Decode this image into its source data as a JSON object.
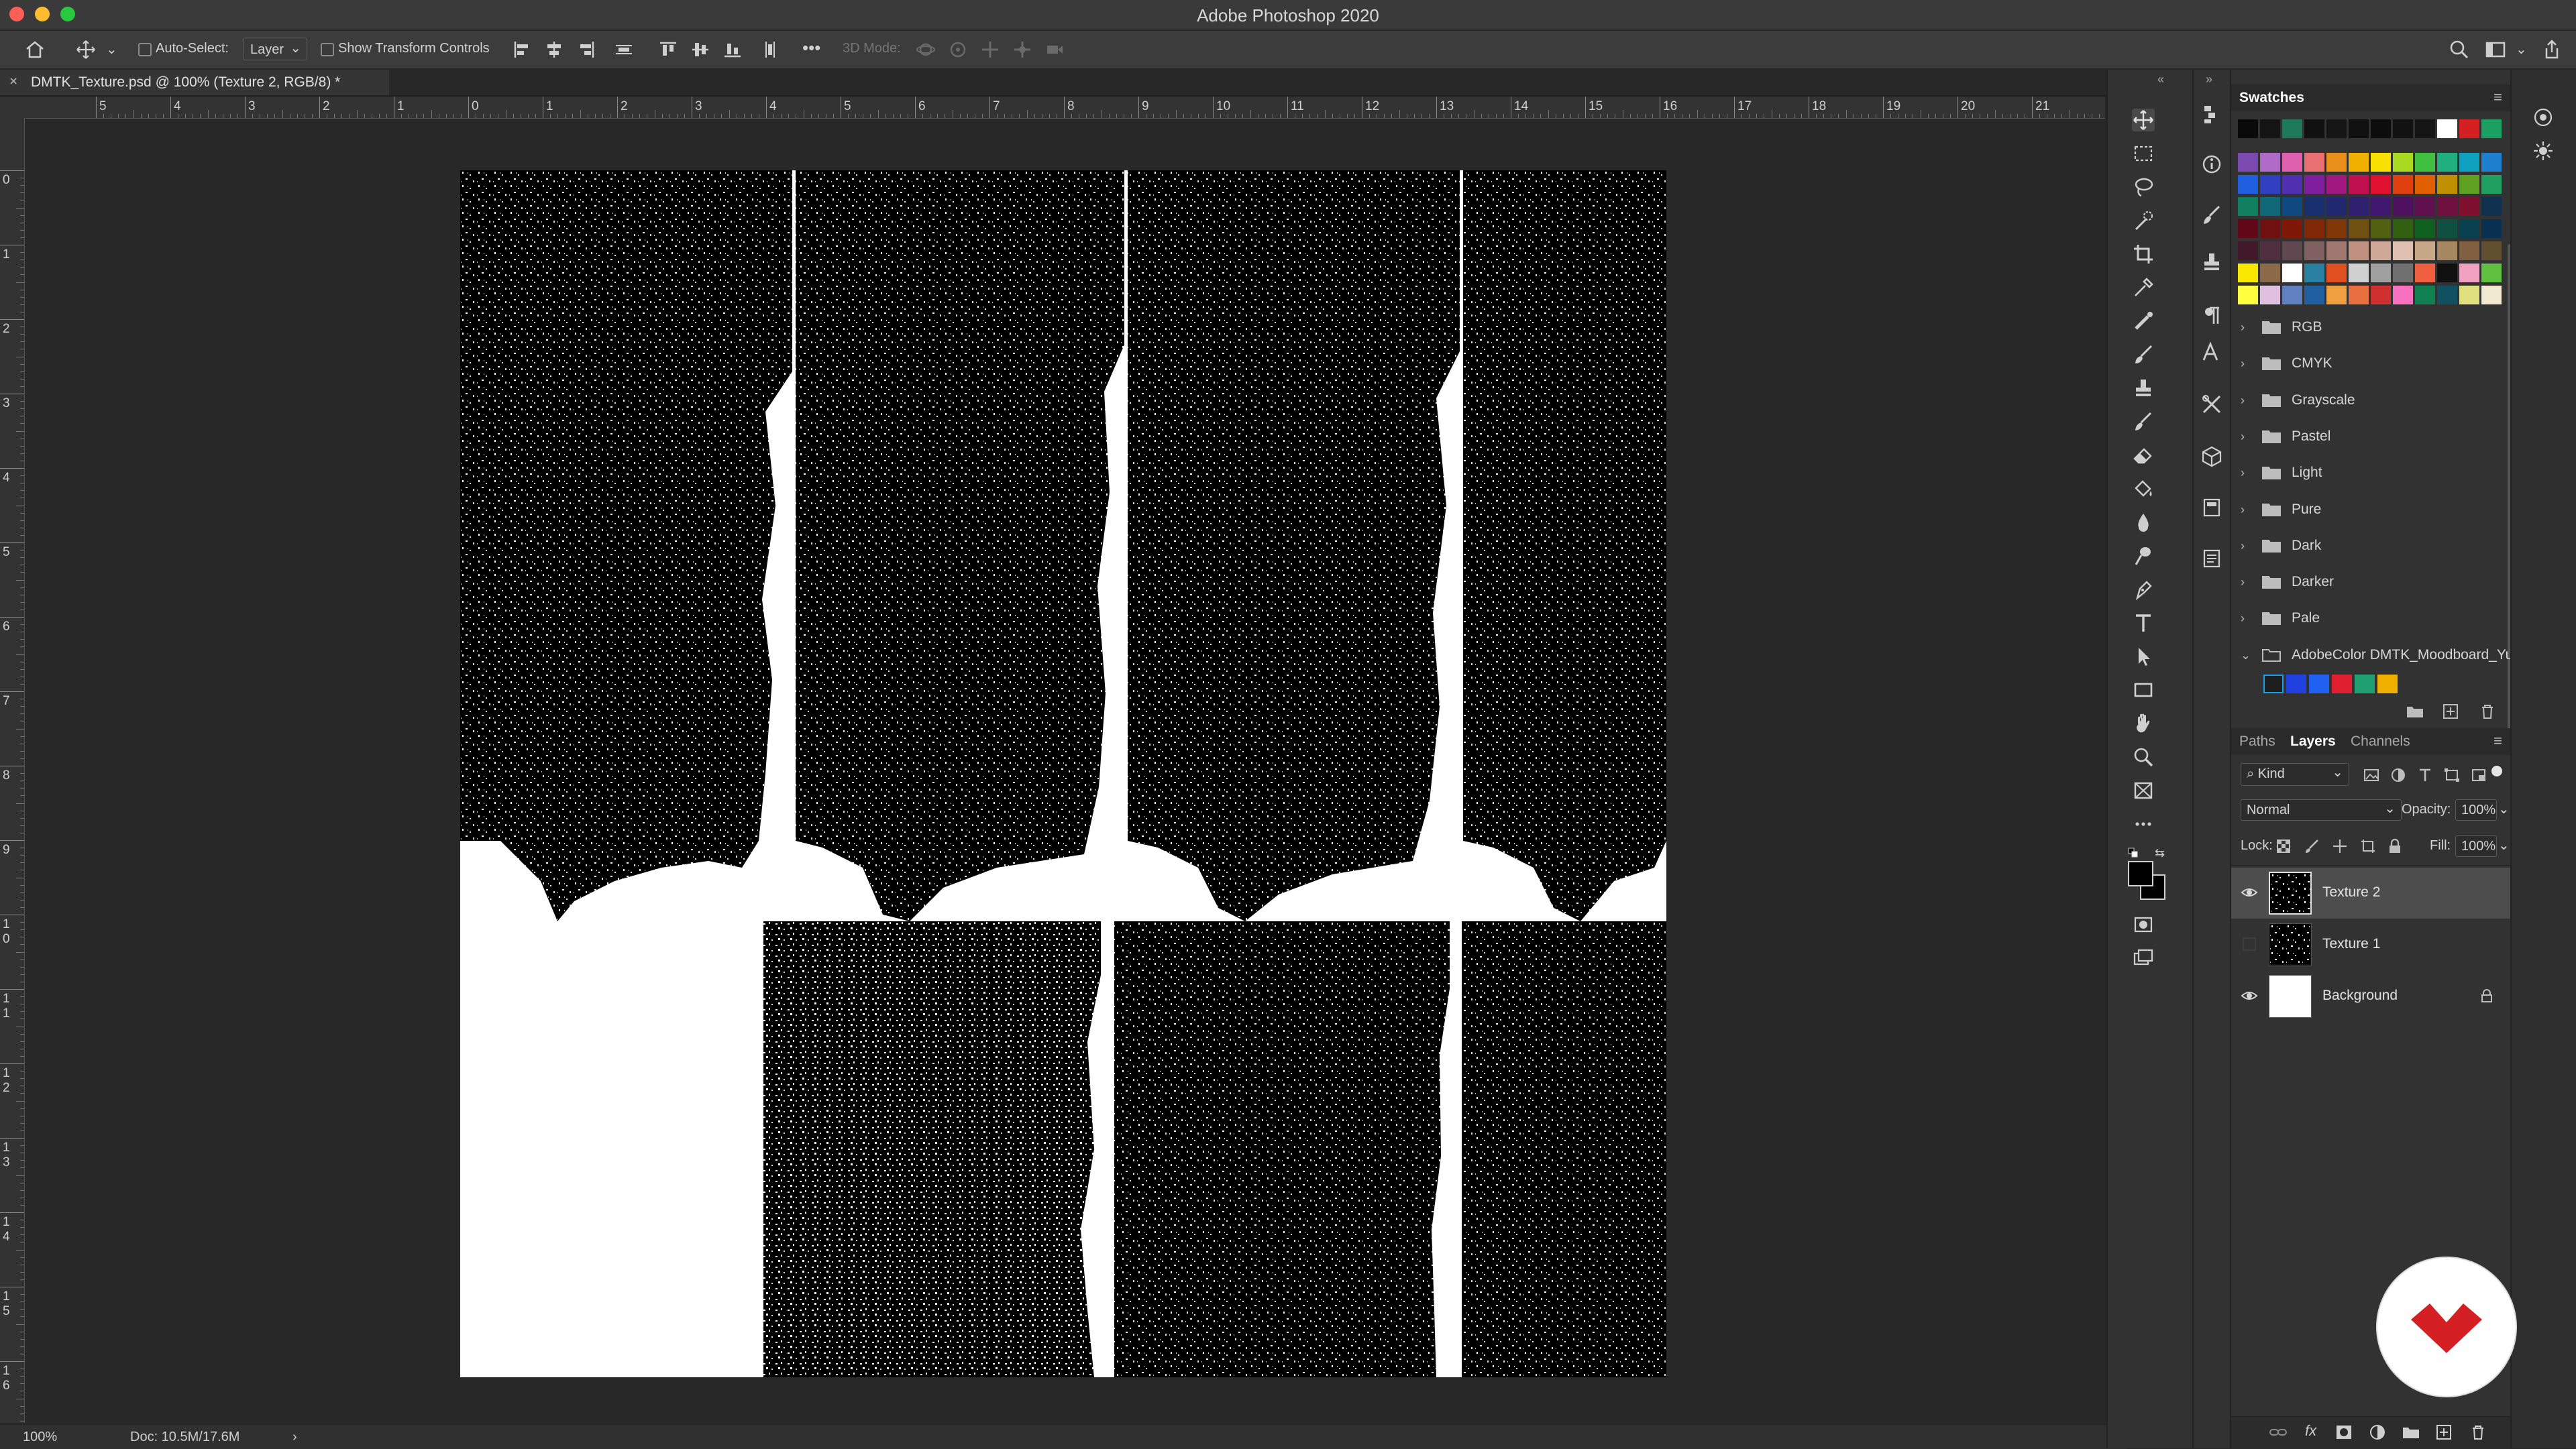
{
  "window": {
    "title": "Adobe Photoshop 2020"
  },
  "options_bar": {
    "auto_select_label": "Auto-Select:",
    "auto_select_value": "Layer",
    "show_transform_label": "Show Transform Controls",
    "mode_3d_label": "3D Mode:",
    "more_label": "•••"
  },
  "document": {
    "tab_title": "DMTK_Texture.psd @ 100% (Texture 2, RGB/8) *",
    "close_label": "×"
  },
  "rulers": {
    "horizontal": [
      "5",
      "4",
      "3",
      "2",
      "1",
      "0",
      "1",
      "2",
      "3",
      "4",
      "5",
      "6",
      "7",
      "8",
      "9",
      "10",
      "11",
      "12",
      "13",
      "14",
      "15",
      "16",
      "17",
      "18",
      "19",
      "20",
      "21",
      "2"
    ],
    "vertical": [
      "0",
      "1",
      "2",
      "3",
      "4",
      "5",
      "6",
      "7",
      "8",
      "9",
      "1\n0",
      "1\n1",
      "1\n2",
      "1\n3",
      "1\n4",
      "1\n5",
      "1\n6"
    ]
  },
  "status_bar": {
    "zoom": "100%",
    "doc_size": "Doc: 10.5M/17.6M",
    "arrow": "›"
  },
  "swatches_panel": {
    "tab_label": "Swatches",
    "recent": [
      "#0a0a0a",
      "#141414",
      "#1e7a5a",
      "#111111",
      "#161616",
      "#101010",
      "#0d0d0d",
      "#121212",
      "#151515",
      "#ffffff",
      "#d42020",
      "#1aa060"
    ],
    "grid": [
      [
        "#7a4ab0",
        "#b06ac8",
        "#e060b0",
        "#e87070",
        "#e8901a",
        "#f0b000",
        "#f8e000",
        "#a8d820",
        "#40c040",
        "#20b080",
        "#10a0c0",
        "#2080d0"
      ],
      [
        "#2060e0",
        "#3040c0",
        "#5030b0",
        "#8020a0",
        "#a01880",
        "#c01050",
        "#e01030",
        "#e04010",
        "#e06000",
        "#c09000",
        "#60a020",
        "#20a060"
      ],
      [
        "#108060",
        "#106878",
        "#104880",
        "#183070",
        "#202870",
        "#302070",
        "#401870",
        "#501060",
        "#601050",
        "#701040",
        "#801030",
        "#103050"
      ],
      [
        "#600818",
        "#701010",
        "#801808",
        "#802808",
        "#803808",
        "#705010",
        "#506010",
        "#306010",
        "#106020",
        "#105040",
        "#084050",
        "#083050"
      ],
      [
        "#401828",
        "#503040",
        "#604850",
        "#806060",
        "#a07870",
        "#c09080",
        "#d0a898",
        "#e0c0b0",
        "#c8a888",
        "#a88860",
        "#806040",
        "#605030"
      ],
      [
        "#f8e800",
        "#8a6a48",
        "#ffffff",
        "#2a80a0",
        "#e05020",
        "#d0d0d0",
        "#a0a0a0",
        "#707070",
        "#f06040",
        "#101010",
        "#f0a0c0",
        "#60c040"
      ],
      [
        "#ffff40",
        "#e0c0e0",
        "#6080c0",
        "#2060a0",
        "#f0a040",
        "#e87040",
        "#d03030",
        "#f870c0",
        "#108050",
        "#105060",
        "#e0e080",
        "#f0e8d0"
      ]
    ],
    "groups": [
      "RGB",
      "CMYK",
      "Grayscale",
      "Pastel",
      "Light",
      "Pure",
      "Dark",
      "Darker",
      "Pale",
      "AdobeColor DMTK_Moodboard_Yu..."
    ],
    "adobecolor_swatches": [
      "#1e1e1e",
      "#2040e0",
      "#2060f0",
      "#e02030",
      "#20a070",
      "#f0b000"
    ]
  },
  "layers_panel": {
    "tabs": [
      "Paths",
      "Layers",
      "Channels"
    ],
    "active_tab": "Layers",
    "kind_label": "Kind",
    "blend_mode": "Normal",
    "opacity_label": "Opacity:",
    "opacity_value": "100%",
    "lock_label": "Lock:",
    "fill_label": "Fill:",
    "fill_value": "100%",
    "layers": [
      {
        "name": "Texture 2",
        "visible": true,
        "selected": true
      },
      {
        "name": "Texture 1",
        "visible": false,
        "selected": false
      },
      {
        "name": "Background",
        "visible": true,
        "selected": false,
        "locked": true
      }
    ]
  },
  "colors": {
    "accent": "#d41f25",
    "canvas_bg": "#282828",
    "panel_bg": "#323232"
  }
}
